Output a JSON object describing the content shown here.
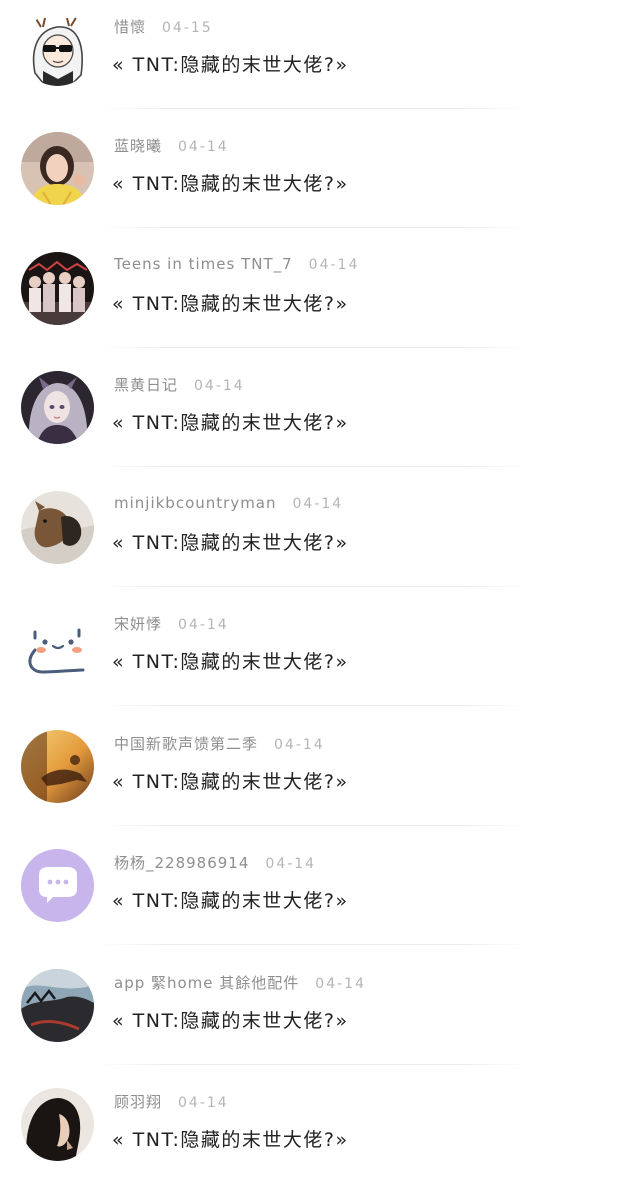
{
  "feed": {
    "items": [
      {
        "user": "惜懷",
        "date": "04-15",
        "title": "« TNT:隐藏的末世大佬?»",
        "avatar_icon": "anime-girl-sunglasses-avatar"
      },
      {
        "user": "蓝晓曦",
        "date": "04-14",
        "title": "« TNT:隐藏的末世大佬?»",
        "avatar_icon": "girl-selfie-avatar"
      },
      {
        "user": "Teens in times TNT_7",
        "date": "04-14",
        "title": "« TNT:隐藏的末世大佬?»",
        "avatar_icon": "group-photo-avatar"
      },
      {
        "user": "黑黄日记",
        "date": "04-14",
        "title": "« TNT:隐藏的末世大佬?»",
        "avatar_icon": "fantasy-girl-avatar"
      },
      {
        "user": "minjikbcountryman",
        "date": "04-14",
        "title": "« TNT:隐藏的末世大佬?»",
        "avatar_icon": "cat-photo-avatar"
      },
      {
        "user": "宋妍悸",
        "date": "04-14",
        "title": "« TNT:隐藏的末世大佬?»",
        "avatar_icon": "cute-face-avatar"
      },
      {
        "user": "中国新歌声馈第二季",
        "date": "04-14",
        "title": "« TNT:隐藏的末世大佬?»",
        "avatar_icon": "sunset-silhouette-avatar"
      },
      {
        "user": "杨杨_228986914",
        "date": "04-14",
        "title": "« TNT:隐藏的末世大佬?»",
        "avatar_icon": "chat-bubble-avatar"
      },
      {
        "user": "app 緊home 其餘他配件",
        "date": "04-14",
        "title": "« TNT:隐藏的末世大佬?»",
        "avatar_icon": "dark-landscape-avatar"
      },
      {
        "user": "顾羽翔",
        "date": "04-14",
        "title": "« TNT:隐藏的末世大佬?»",
        "avatar_icon": "woman-profile-avatar"
      }
    ]
  },
  "colors": {
    "background": "#ffffff",
    "username": "#8e8e8e",
    "date": "#b5b5b5",
    "title": "#222222",
    "divider": "#ececec",
    "chat_avatar_bg": "#c7b5ec"
  }
}
